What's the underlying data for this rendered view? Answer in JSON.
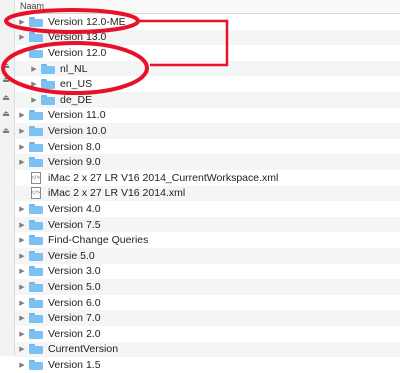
{
  "header": {
    "column_name": "Naam"
  },
  "items": [
    {
      "label": "Version 12.0-ME",
      "type": "folder",
      "level": 0,
      "expandable": true,
      "expanded": false
    },
    {
      "label": "Version 13.0",
      "type": "folder",
      "level": 0,
      "expandable": true,
      "expanded": false
    },
    {
      "label": "Version 12.0",
      "type": "folder",
      "level": 0,
      "expandable": true,
      "expanded": true
    },
    {
      "label": "nl_NL",
      "type": "folder",
      "level": 1,
      "expandable": true,
      "expanded": false
    },
    {
      "label": "en_US",
      "type": "folder",
      "level": 1,
      "expandable": true,
      "expanded": false
    },
    {
      "label": "de_DE",
      "type": "folder",
      "level": 1,
      "expandable": true,
      "expanded": false
    },
    {
      "label": "Version 11.0",
      "type": "folder",
      "level": 0,
      "expandable": true,
      "expanded": false
    },
    {
      "label": "Version 10.0",
      "type": "folder",
      "level": 0,
      "expandable": true,
      "expanded": false
    },
    {
      "label": "Version 8.0",
      "type": "folder",
      "level": 0,
      "expandable": true,
      "expanded": false
    },
    {
      "label": "Version 9.0",
      "type": "folder",
      "level": 0,
      "expandable": true,
      "expanded": false
    },
    {
      "label": "iMac 2 x 27 LR V16 2014_CurrentWorkspace.xml",
      "type": "file",
      "level": 0,
      "expandable": false,
      "expanded": false
    },
    {
      "label": "iMac 2 x 27 LR V16 2014.xml",
      "type": "file",
      "level": 0,
      "expandable": false,
      "expanded": false
    },
    {
      "label": "Version 4.0",
      "type": "folder",
      "level": 0,
      "expandable": true,
      "expanded": false
    },
    {
      "label": "Version 7.5",
      "type": "folder",
      "level": 0,
      "expandable": true,
      "expanded": false
    },
    {
      "label": "Find-Change Queries",
      "type": "folder",
      "level": 0,
      "expandable": true,
      "expanded": false
    },
    {
      "label": "Versie 5.0",
      "type": "folder",
      "level": 0,
      "expandable": true,
      "expanded": false
    },
    {
      "label": "Version 3.0",
      "type": "folder",
      "level": 0,
      "expandable": true,
      "expanded": false
    },
    {
      "label": "Version 5.0",
      "type": "folder",
      "level": 0,
      "expandable": true,
      "expanded": false
    },
    {
      "label": "Version 6.0",
      "type": "folder",
      "level": 0,
      "expandable": true,
      "expanded": false
    },
    {
      "label": "Version 7.0",
      "type": "folder",
      "level": 0,
      "expandable": true,
      "expanded": false
    },
    {
      "label": "Version 2.0",
      "type": "folder",
      "level": 0,
      "expandable": true,
      "expanded": false
    },
    {
      "label": "CurrentVersion",
      "type": "folder",
      "level": 0,
      "expandable": true,
      "expanded": false
    },
    {
      "label": "Version 1.5",
      "type": "folder",
      "level": 0,
      "expandable": true,
      "expanded": false
    }
  ],
  "icons": {
    "collapsed": "disclosure-triangle-right-icon",
    "expanded": "disclosure-triangle-down-icon",
    "folder": "folder-icon",
    "file": "xml-file-icon",
    "eject": "eject-icon"
  },
  "colors": {
    "annotation_red": "#e8102a",
    "folder_blue": "#7cc1f4",
    "alt_row": "#f4f5f5"
  }
}
